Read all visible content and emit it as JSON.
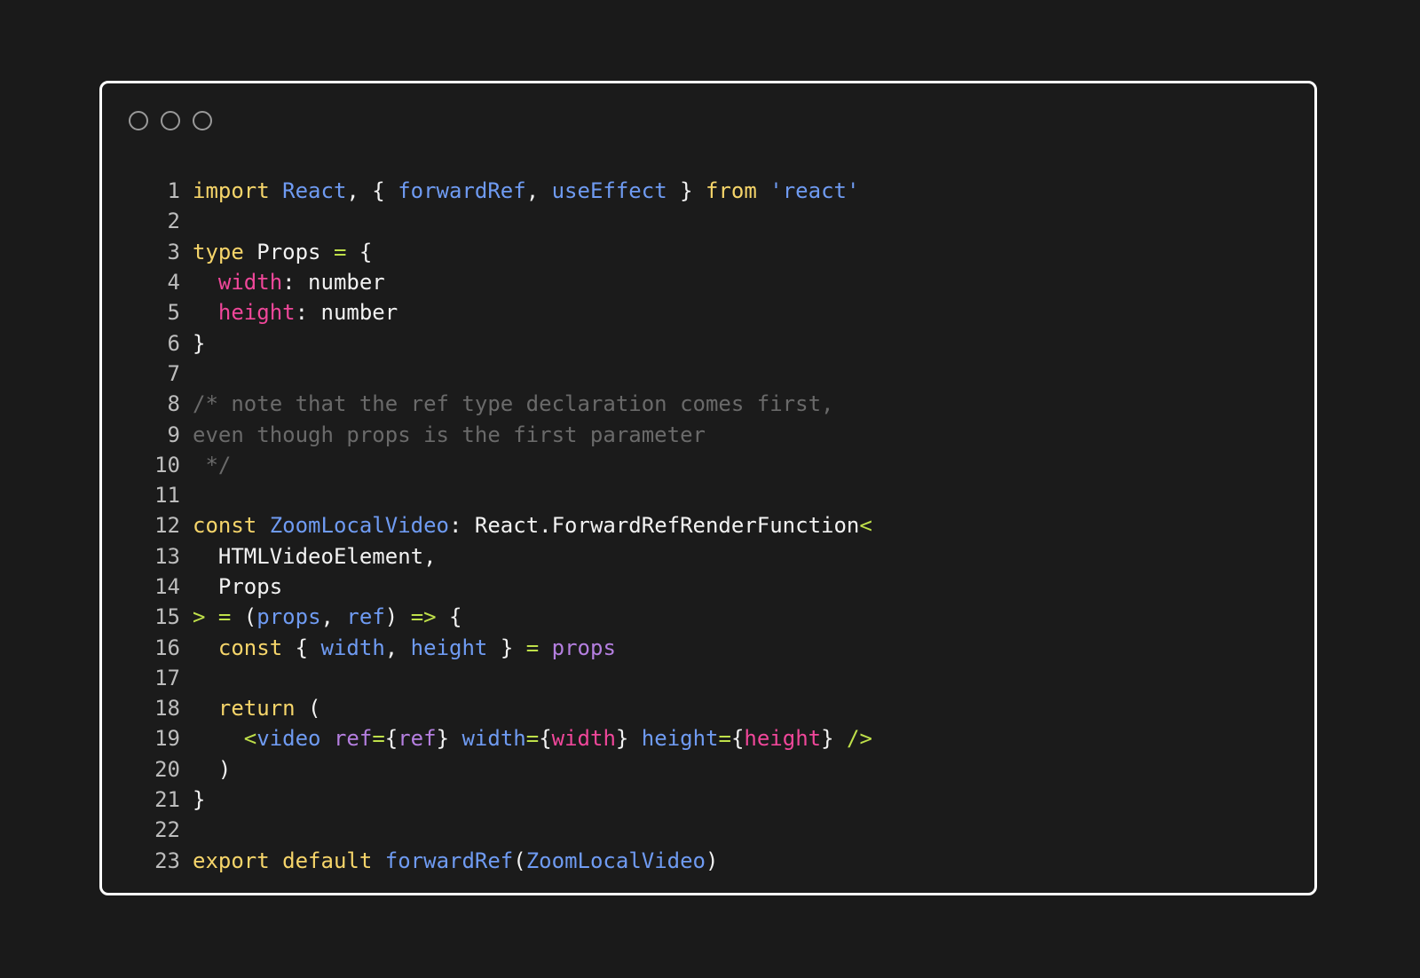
{
  "window_controls": [
    "circle",
    "circle",
    "circle"
  ],
  "colors": {
    "background": "#1a1a1a",
    "window_border": "#ffffff",
    "keyword": "#f6d56a",
    "identifier": "#6f9bf2",
    "string": "#6f9bf2",
    "property": "#f0479a",
    "comment": "#6a6a6a",
    "plain": "#f2f2f2",
    "operator": "#bfe04a",
    "punct": "#f2f2f2",
    "purple": "#b57fe0",
    "line_number": "#bdbdbd"
  },
  "code_lines": [
    {
      "n": "1",
      "tokens": [
        {
          "t": "import",
          "c": "keyword"
        },
        {
          "t": " ",
          "c": "plain"
        },
        {
          "t": "React",
          "c": "identifier"
        },
        {
          "t": ", { ",
          "c": "punct"
        },
        {
          "t": "forwardRef",
          "c": "identifier"
        },
        {
          "t": ", ",
          "c": "punct"
        },
        {
          "t": "useEffect",
          "c": "identifier"
        },
        {
          "t": " } ",
          "c": "punct"
        },
        {
          "t": "from",
          "c": "keyword"
        },
        {
          "t": " ",
          "c": "plain"
        },
        {
          "t": "'react'",
          "c": "string"
        }
      ]
    },
    {
      "n": "2",
      "tokens": []
    },
    {
      "n": "3",
      "tokens": [
        {
          "t": "type",
          "c": "keyword"
        },
        {
          "t": " Props ",
          "c": "plain"
        },
        {
          "t": "=",
          "c": "operator"
        },
        {
          "t": " {",
          "c": "punct"
        }
      ]
    },
    {
      "n": "4",
      "tokens": [
        {
          "t": "  ",
          "c": "plain"
        },
        {
          "t": "width",
          "c": "property"
        },
        {
          "t": ": number",
          "c": "plain"
        }
      ]
    },
    {
      "n": "5",
      "tokens": [
        {
          "t": "  ",
          "c": "plain"
        },
        {
          "t": "height",
          "c": "property"
        },
        {
          "t": ": number",
          "c": "plain"
        }
      ]
    },
    {
      "n": "6",
      "tokens": [
        {
          "t": "}",
          "c": "punct"
        }
      ]
    },
    {
      "n": "7",
      "tokens": []
    },
    {
      "n": "8",
      "tokens": [
        {
          "t": "/* note that the ref type declaration comes first,",
          "c": "comment"
        }
      ]
    },
    {
      "n": "9",
      "tokens": [
        {
          "t": "even though props is the first parameter",
          "c": "comment"
        }
      ]
    },
    {
      "n": "10",
      "tokens": [
        {
          "t": " */",
          "c": "comment"
        }
      ]
    },
    {
      "n": "11",
      "tokens": []
    },
    {
      "n": "12",
      "tokens": [
        {
          "t": "const",
          "c": "keyword"
        },
        {
          "t": " ",
          "c": "plain"
        },
        {
          "t": "ZoomLocalVideo",
          "c": "identifier"
        },
        {
          "t": ": React.ForwardRefRenderFunction",
          "c": "plain"
        },
        {
          "t": "<",
          "c": "operator"
        }
      ]
    },
    {
      "n": "13",
      "tokens": [
        {
          "t": "  HTMLVideoElement,",
          "c": "plain"
        }
      ]
    },
    {
      "n": "14",
      "tokens": [
        {
          "t": "  Props",
          "c": "plain"
        }
      ]
    },
    {
      "n": "15",
      "tokens": [
        {
          "t": ">",
          "c": "operator"
        },
        {
          "t": " ",
          "c": "plain"
        },
        {
          "t": "=",
          "c": "operator"
        },
        {
          "t": " (",
          "c": "punct"
        },
        {
          "t": "props",
          "c": "identifier"
        },
        {
          "t": ", ",
          "c": "punct"
        },
        {
          "t": "ref",
          "c": "identifier"
        },
        {
          "t": ") ",
          "c": "punct"
        },
        {
          "t": "=>",
          "c": "operator"
        },
        {
          "t": " {",
          "c": "punct"
        }
      ]
    },
    {
      "n": "16",
      "tokens": [
        {
          "t": "  ",
          "c": "plain"
        },
        {
          "t": "const",
          "c": "keyword"
        },
        {
          "t": " { ",
          "c": "punct"
        },
        {
          "t": "width",
          "c": "identifier"
        },
        {
          "t": ", ",
          "c": "punct"
        },
        {
          "t": "height",
          "c": "identifier"
        },
        {
          "t": " } ",
          "c": "punct"
        },
        {
          "t": "=",
          "c": "operator"
        },
        {
          "t": " ",
          "c": "plain"
        },
        {
          "t": "props",
          "c": "purple"
        }
      ]
    },
    {
      "n": "17",
      "tokens": []
    },
    {
      "n": "18",
      "tokens": [
        {
          "t": "  ",
          "c": "plain"
        },
        {
          "t": "return",
          "c": "keyword"
        },
        {
          "t": " (",
          "c": "punct"
        }
      ]
    },
    {
      "n": "19",
      "tokens": [
        {
          "t": "    ",
          "c": "plain"
        },
        {
          "t": "<",
          "c": "operator"
        },
        {
          "t": "video",
          "c": "identifier"
        },
        {
          "t": " ",
          "c": "plain"
        },
        {
          "t": "ref",
          "c": "purple"
        },
        {
          "t": "=",
          "c": "operator"
        },
        {
          "t": "{",
          "c": "punct"
        },
        {
          "t": "ref",
          "c": "purple"
        },
        {
          "t": "} ",
          "c": "punct"
        },
        {
          "t": "width",
          "c": "identifier"
        },
        {
          "t": "=",
          "c": "operator"
        },
        {
          "t": "{",
          "c": "punct"
        },
        {
          "t": "width",
          "c": "property"
        },
        {
          "t": "} ",
          "c": "punct"
        },
        {
          "t": "height",
          "c": "identifier"
        },
        {
          "t": "=",
          "c": "operator"
        },
        {
          "t": "{",
          "c": "punct"
        },
        {
          "t": "height",
          "c": "property"
        },
        {
          "t": "} ",
          "c": "punct"
        },
        {
          "t": "/>",
          "c": "operator"
        }
      ]
    },
    {
      "n": "20",
      "tokens": [
        {
          "t": "  )",
          "c": "punct"
        }
      ]
    },
    {
      "n": "21",
      "tokens": [
        {
          "t": "}",
          "c": "punct"
        }
      ]
    },
    {
      "n": "22",
      "tokens": []
    },
    {
      "n": "23",
      "tokens": [
        {
          "t": "export",
          "c": "keyword"
        },
        {
          "t": " ",
          "c": "plain"
        },
        {
          "t": "default",
          "c": "keyword"
        },
        {
          "t": " ",
          "c": "plain"
        },
        {
          "t": "forwardRef",
          "c": "identifier"
        },
        {
          "t": "(",
          "c": "punct"
        },
        {
          "t": "ZoomLocalVideo",
          "c": "identifier"
        },
        {
          "t": ")",
          "c": "punct"
        }
      ]
    }
  ]
}
